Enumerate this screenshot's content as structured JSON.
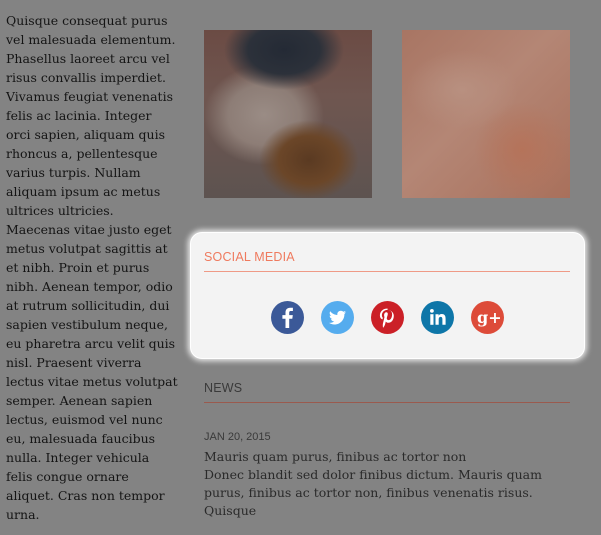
{
  "article": {
    "text": "Quisque consequat purus vel malesuada elementum. Phasellus laoreet arcu vel risus convallis imperdiet. Vivamus feugiat venenatis felis ac lacinia. Integer orci sapien, aliquam quis rhoncus a, pellentesque varius turpis. Nullam aliquam ipsum ac metus ultrices ultricies. Maecenas vitae justo eget metus volutpat sagittis at et nibh. Proin et purus nibh. Aenean tempor, odio at rutrum sollicitudin, dui sapien vestibulum neque, eu pharetra arcu velit quis nisl. Praesent viverra lectus vitae metus volutpat semper. Aenean sapien lectus, euismod vel nunc eu, malesuada faucibus nulla. Integer vehicula felis congue ornare aliquet. Cras non tempor urna."
  },
  "social": {
    "title": "SOCIAL MEDIA",
    "icons": [
      {
        "name": "facebook-icon",
        "glyph": "f",
        "color": "#3b5998"
      },
      {
        "name": "twitter-icon",
        "glyph": "t",
        "color": "#55acee"
      },
      {
        "name": "pinterest-icon",
        "glyph": "P",
        "color": "#cb2027"
      },
      {
        "name": "linkedin-icon",
        "glyph": "in",
        "color": "#0e76a8"
      },
      {
        "name": "google-plus-icon",
        "glyph": "g+",
        "color": "#dd4b39"
      }
    ]
  },
  "news": {
    "title": "NEWS",
    "items": [
      {
        "date": "JAN 20, 2015",
        "headline": "Mauris quam purus, finibus ac tortor non",
        "excerpt": "Donec blandit sed dolor finibus dictum. Mauris quam purus, finibus ac tortor non, finibus venenatis risus. Quisque"
      }
    ]
  },
  "colors": {
    "overlay": "#838383",
    "accent": "#ef7a5e",
    "panel": "#f3f3f3"
  }
}
